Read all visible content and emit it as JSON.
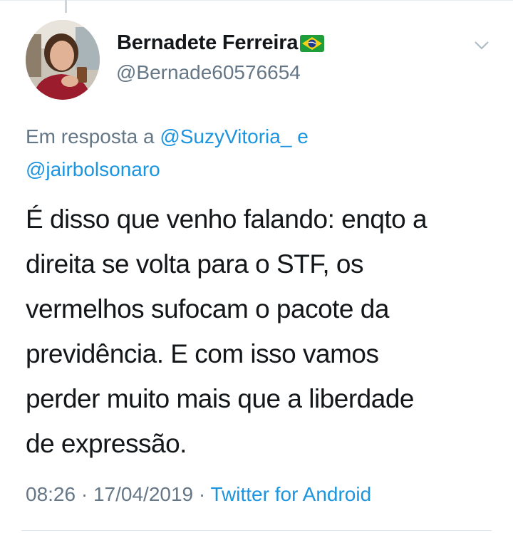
{
  "author": {
    "name": "Bernadete Ferreira",
    "handle": "@Bernade60576654",
    "flag_icon": "brazil-flag-icon"
  },
  "reply": {
    "prefix": "Em resposta a ",
    "mention1": "@SuzyVitoria_",
    "connector": " e",
    "mention2": "@jairbolsonaro"
  },
  "tweet_lines": [
    "É disso que venho falando: enqto a",
    "direita se volta para o STF, os",
    "vermelhos sufocam o pacote da",
    "previdência.  E com isso vamos",
    "perder muito mais que a liberdade",
    "de expressão."
  ],
  "meta": {
    "time": "08:26",
    "separator1": " · ",
    "date": "17/04/2019",
    "separator2": " · ",
    "source": "Twitter for Android"
  },
  "colors": {
    "link": "#1b95e0",
    "secondary_text": "#657786",
    "primary_text": "#14171a"
  }
}
